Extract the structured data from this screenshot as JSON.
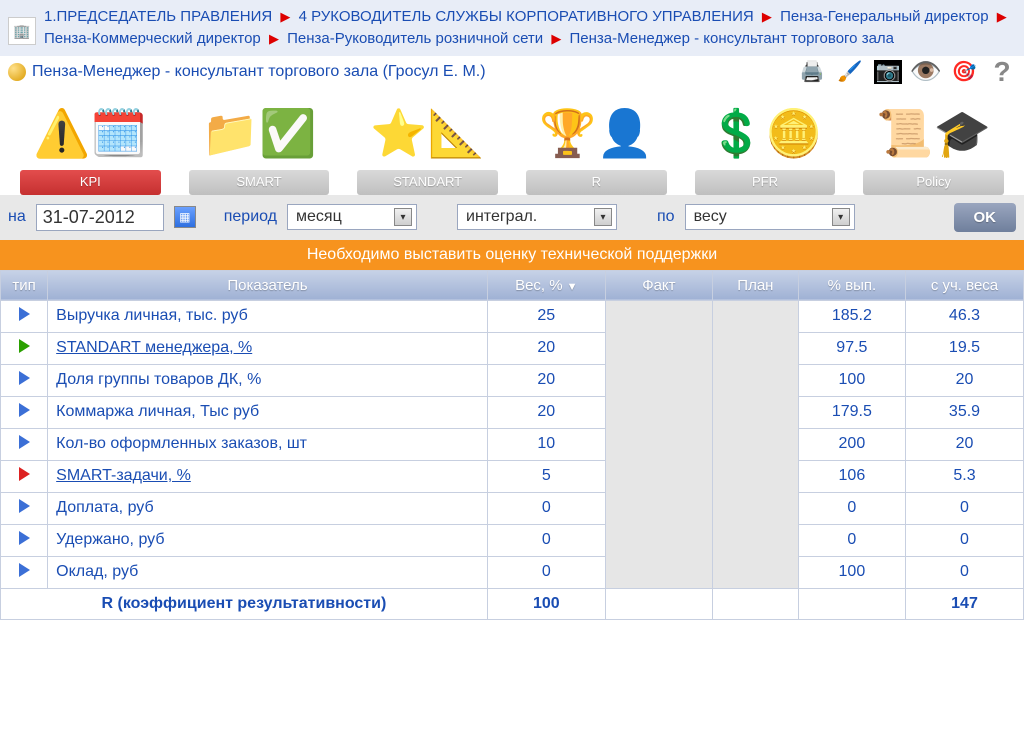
{
  "breadcrumb": {
    "parts": [
      "1.ПРЕДСЕДАТЕЛЬ ПРАВЛЕНИЯ",
      "4 РУКОВОДИТЕЛЬ СЛУЖБЫ КОРПОРАТИВНОГО УПРАВЛЕНИЯ",
      "Пенза-Генеральный директор",
      "Пенза-Коммерческий директор",
      "Пенза-Руководитель розничной сети",
      "Пенза-Менеджер - консультант торгового зала"
    ]
  },
  "title": "Пенза-Менеджер - консультант торгового зала  (Гросул Е. М.)",
  "toolbar_icons": {
    "print": "🖨️",
    "brush": "🖌️",
    "camera": "📷",
    "eye": "👁️",
    "target": "🎯",
    "help": "?"
  },
  "tabs": [
    {
      "label": "KPI",
      "active": true
    },
    {
      "label": "SMART",
      "active": false
    },
    {
      "label": "STANDART",
      "active": false
    },
    {
      "label": "R",
      "active": false
    },
    {
      "label": "PFR",
      "active": false
    },
    {
      "label": "Policy",
      "active": false
    }
  ],
  "filters": {
    "date_label": "на",
    "date_value": "31-07-2012",
    "period_label": "период",
    "period_value": "месяц",
    "mode_value": "интеграл.",
    "by_label": "по",
    "by_value": "весу",
    "ok": "OK"
  },
  "banner": "Необходимо выставить оценку технической поддержки",
  "columns": {
    "type": "тип",
    "name": "Показатель",
    "weight": "Вес, %",
    "fact": "Факт",
    "plan": "План",
    "pct": "% вып.",
    "weighted": "с уч. веса"
  },
  "rows": [
    {
      "tri": "blue",
      "name": "Выручка личная, тыс. руб",
      "link": false,
      "weight": "25",
      "pct": "185.2",
      "weighted": "46.3"
    },
    {
      "tri": "green",
      "name": "STANDART менеджера, %",
      "link": true,
      "weight": "20",
      "pct": "97.5",
      "weighted": "19.5"
    },
    {
      "tri": "blue",
      "name": "Доля группы товаров ДК, %",
      "link": false,
      "weight": "20",
      "pct": "100",
      "weighted": "20"
    },
    {
      "tri": "blue",
      "name": "Коммаржа личная, Тыс руб",
      "link": false,
      "weight": "20",
      "pct": "179.5",
      "weighted": "35.9"
    },
    {
      "tri": "blue",
      "name": "Кол-во оформленных заказов, шт",
      "link": false,
      "weight": "10",
      "pct": "200",
      "weighted": "20"
    },
    {
      "tri": "red",
      "name": "SMART-задачи, %",
      "link": true,
      "weight": "5",
      "pct": "106",
      "weighted": "5.3"
    },
    {
      "tri": "blue",
      "name": "Доплата, руб",
      "link": false,
      "weight": "0",
      "pct": "0",
      "weighted": "0"
    },
    {
      "tri": "blue",
      "name": "Удержано, руб",
      "link": false,
      "weight": "0",
      "pct": "0",
      "weighted": "0"
    },
    {
      "tri": "blue",
      "name": "Оклад, руб",
      "link": false,
      "weight": "0",
      "pct": "100",
      "weighted": "0"
    }
  ],
  "footer": {
    "label": "R (коэффициент результативности)",
    "weight_total": "100",
    "weighted_total": "147"
  }
}
